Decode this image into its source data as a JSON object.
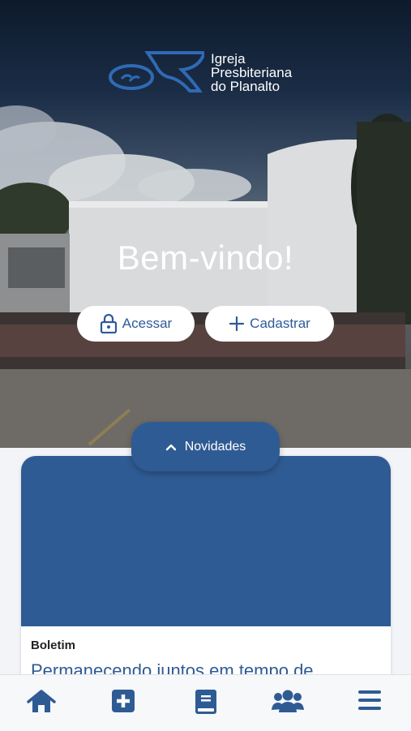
{
  "logo": {
    "line1": "Igreja",
    "line2": "Presbiteriana",
    "line3": "do Planalto"
  },
  "hero": {
    "welcome": "Bem-vindo!",
    "login_label": "Acessar",
    "signup_label": "Cadastrar"
  },
  "news": {
    "tab_label": "Novidades",
    "card": {
      "category": "Boletim",
      "title": "Permanecendo juntos em tempo de"
    }
  },
  "tabbar": {
    "items": [
      {
        "icon": "home-icon"
      },
      {
        "icon": "medical-plus-icon"
      },
      {
        "icon": "book-icon"
      },
      {
        "icon": "users-icon"
      },
      {
        "icon": "menu-icon"
      }
    ]
  },
  "colors": {
    "brand_blue": "#2f5b94",
    "white": "#ffffff"
  }
}
